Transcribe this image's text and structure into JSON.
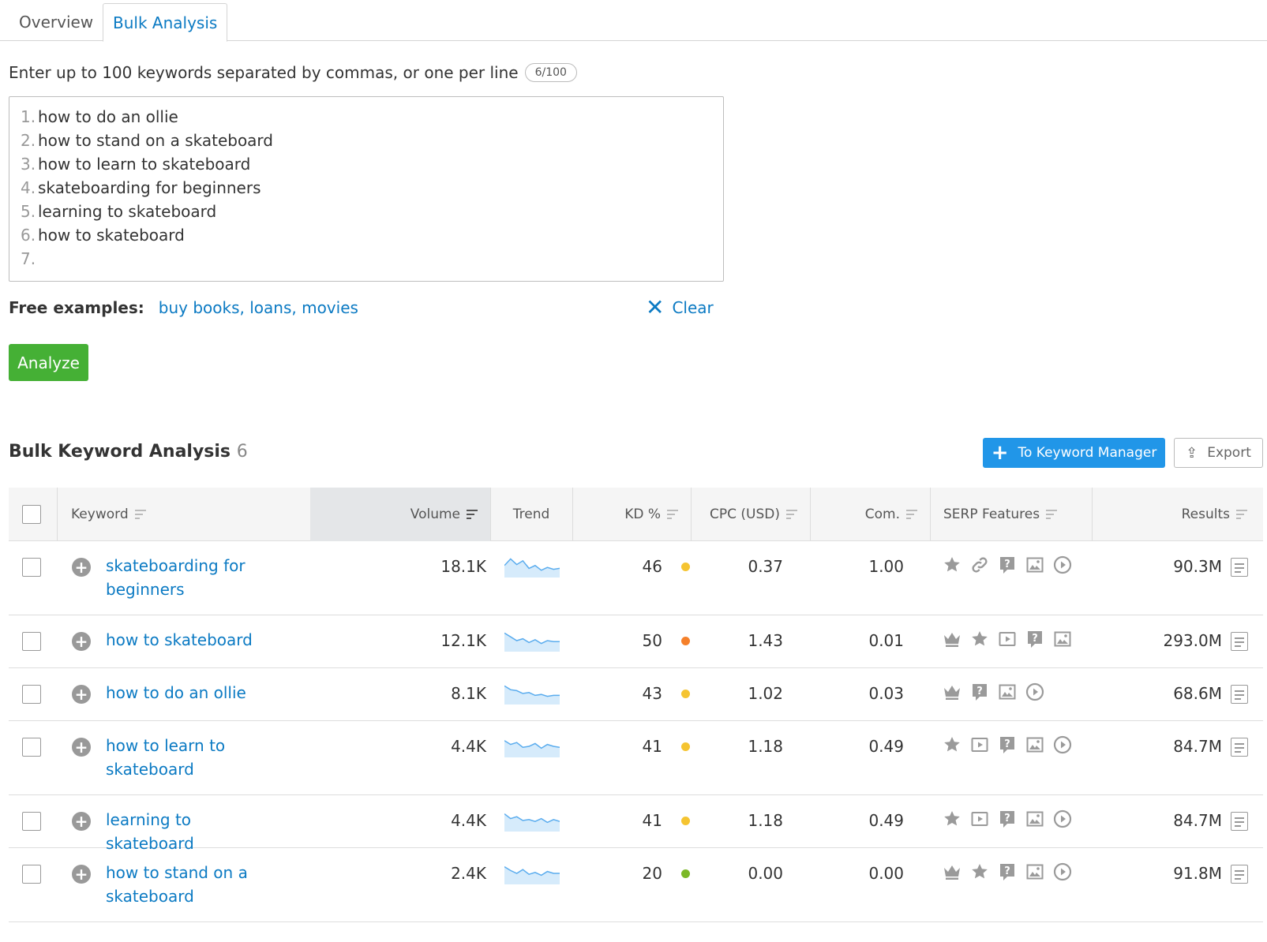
{
  "tabs": [
    {
      "label": "Overview"
    },
    {
      "label": "Bulk Analysis",
      "active": true
    }
  ],
  "input": {
    "prompt": "Enter up to 100 keywords separated by commas, or one per line",
    "counter": "6/100",
    "lines": [
      {
        "num": "1.",
        "text": "how to do an ollie"
      },
      {
        "num": "2.",
        "text": "how to stand on a skateboard"
      },
      {
        "num": "3.",
        "text": "how to learn to skateboard"
      },
      {
        "num": "4.",
        "text": "skateboarding for beginners"
      },
      {
        "num": "5.",
        "text": "learning to skateboard"
      },
      {
        "num": "6.",
        "text": "how to skateboard"
      },
      {
        "num": "7.",
        "text": ""
      }
    ]
  },
  "examples": {
    "label": "Free examples:",
    "link": "buy books, loans, movies"
  },
  "clear_label": "Clear",
  "analyze_label": "Analyze",
  "section": {
    "title": "Bulk Keyword Analysis",
    "count": "6"
  },
  "buttons": {
    "keyword_manager": "To Keyword Manager",
    "export": "Export"
  },
  "columns": {
    "keyword": "Keyword",
    "volume": "Volume",
    "trend": "Trend",
    "kd": "KD %",
    "cpc": "CPC (USD)",
    "com": "Com.",
    "serp": "SERP Features",
    "results": "Results"
  },
  "colors": {
    "accent": "#0b7ac3",
    "analyze_green": "#45b035",
    "primary_blue": "#2196e8",
    "kd_yellow": "#f5c431",
    "kd_orange": "#f5802a",
    "kd_green": "#7bb827",
    "trend": "#5aacee"
  },
  "rows": [
    {
      "keyword": "skateboarding for beginners",
      "volume": "18.1K",
      "kd": "46",
      "kd_color": "#f5c431",
      "cpc": "0.37",
      "com": "1.00",
      "results": "90.3M",
      "serp": [
        "star-icon",
        "link-icon",
        "question-icon",
        "image-icon",
        "play-icon"
      ],
      "trend": [
        0.55,
        0.9,
        0.6,
        0.8,
        0.4,
        0.55,
        0.3,
        0.45,
        0.35,
        0.4
      ]
    },
    {
      "keyword": "how to skateboard",
      "volume": "12.1K",
      "kd": "50",
      "kd_color": "#f5802a",
      "cpc": "1.43",
      "com": "0.01",
      "results": "293.0M",
      "serp": [
        "crown-icon",
        "star-icon",
        "video-icon",
        "question-icon",
        "image-icon"
      ],
      "trend": [
        0.9,
        0.7,
        0.5,
        0.6,
        0.4,
        0.55,
        0.35,
        0.5,
        0.45,
        0.45
      ]
    },
    {
      "keyword": "how to do an ollie",
      "volume": "8.1K",
      "kd": "43",
      "kd_color": "#f5c431",
      "cpc": "1.02",
      "com": "0.03",
      "results": "68.6M",
      "serp": [
        "crown-icon",
        "question-icon",
        "image-icon",
        "play-icon"
      ],
      "trend": [
        0.9,
        0.7,
        0.65,
        0.5,
        0.55,
        0.4,
        0.45,
        0.35,
        0.4,
        0.4
      ]
    },
    {
      "keyword": "how to learn to skateboard",
      "volume": "4.4K",
      "kd": "41",
      "kd_color": "#f5c431",
      "cpc": "1.18",
      "com": "0.49",
      "results": "84.7M",
      "serp": [
        "star-icon",
        "video-icon",
        "question-icon",
        "image-icon",
        "play-icon"
      ],
      "trend": [
        0.8,
        0.6,
        0.7,
        0.45,
        0.5,
        0.65,
        0.4,
        0.6,
        0.5,
        0.45
      ]
    },
    {
      "keyword": "learning to skateboard",
      "volume": "4.4K",
      "kd": "41",
      "kd_color": "#f5c431",
      "cpc": "1.18",
      "com": "0.49",
      "results": "84.7M",
      "serp": [
        "star-icon",
        "video-icon",
        "question-icon",
        "image-icon",
        "play-icon"
      ],
      "trend": [
        0.85,
        0.6,
        0.7,
        0.5,
        0.55,
        0.45,
        0.6,
        0.4,
        0.55,
        0.45
      ]
    },
    {
      "keyword": "how to stand on a skateboard",
      "volume": "2.4K",
      "kd": "20",
      "kd_color": "#7bb827",
      "cpc": "0.00",
      "com": "0.00",
      "results": "91.8M",
      "serp": [
        "crown-icon",
        "star-icon",
        "question-icon",
        "image-icon",
        "play-icon"
      ],
      "trend": [
        0.85,
        0.65,
        0.5,
        0.7,
        0.45,
        0.55,
        0.4,
        0.6,
        0.5,
        0.5
      ]
    }
  ]
}
